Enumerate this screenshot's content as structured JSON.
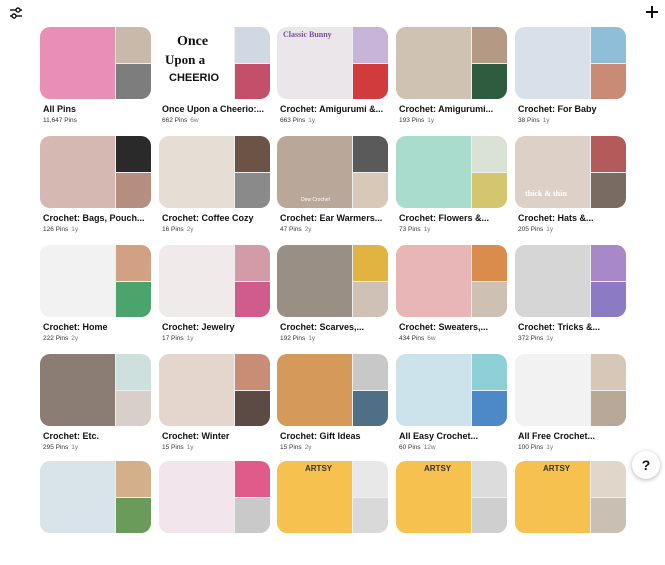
{
  "toolbar": {
    "filter_icon": "filter-sliders-icon",
    "add_icon": "plus-icon"
  },
  "help": {
    "label": "?"
  },
  "boards": [
    {
      "title": "All Pins",
      "count": "11,647 Pins",
      "age": "",
      "colors": [
        "#e98fb5",
        "#c9b9a8",
        "#7d7d7d"
      ]
    },
    {
      "title": "Once Upon a Cheerio:...",
      "count": "662 Pins",
      "age": "6w",
      "colors": [
        "#ffffff",
        "#d0d9e3",
        "#c34f6b"
      ]
    },
    {
      "title": "Crochet: Amigurumi &...",
      "count": "663 Pins",
      "age": "1y",
      "colors": [
        "#eae6ea",
        "#c8b3d9",
        "#d23b3b"
      ]
    },
    {
      "title": "Crochet: Amigurumi...",
      "count": "193 Pins",
      "age": "1y",
      "colors": [
        "#cfc2b3",
        "#b49a85",
        "#2f5c3f"
      ]
    },
    {
      "title": "Crochet: For Baby",
      "count": "38 Pins",
      "age": "1y",
      "colors": [
        "#d8e1e9",
        "#8fbfd8",
        "#c98b73"
      ]
    },
    {
      "title": "Crochet: Bags, Pouch...",
      "count": "126 Pins",
      "age": "1y",
      "colors": [
        "#d5b8b2",
        "#2a2a2a",
        "#b58e7f"
      ]
    },
    {
      "title": "Crochet: Coffee Cozy",
      "count": "16 Pins",
      "age": "2y",
      "colors": [
        "#e6ddd4",
        "#6b5445",
        "#8a8a8a"
      ]
    },
    {
      "title": "Crochet: Ear Warmers...",
      "count": "47 Pins",
      "age": "2y",
      "colors": [
        "#b9a89a",
        "#5a5a5a",
        "#d8c8b8"
      ]
    },
    {
      "title": "Crochet: Flowers &...",
      "count": "73 Pins",
      "age": "1y",
      "colors": [
        "#a9dccd",
        "#d9e2d5",
        "#d4c66e"
      ]
    },
    {
      "title": "Crochet: Hats &...",
      "count": "205 Pins",
      "age": "1y",
      "colors": [
        "#ddd0c6",
        "#b55a5a",
        "#7a6b62"
      ]
    },
    {
      "title": "Crochet: Home",
      "count": "222 Pins",
      "age": "2y",
      "colors": [
        "#f2f2f2",
        "#d2a184",
        "#4aa46b"
      ]
    },
    {
      "title": "Crochet: Jewelry",
      "count": "17 Pins",
      "age": "1y",
      "colors": [
        "#f0eaea",
        "#d39aa8",
        "#cf5c8a"
      ]
    },
    {
      "title": "Crochet: Scarves,...",
      "count": "192 Pins",
      "age": "1y",
      "colors": [
        "#9a8f85",
        "#e2b340",
        "#cfc1b6"
      ]
    },
    {
      "title": "Crochet: Sweaters,...",
      "count": "434 Pins",
      "age": "6w",
      "colors": [
        "#e9b6b8",
        "#d98c4b",
        "#cfc0b4"
      ]
    },
    {
      "title": "Crochet: Tricks &...",
      "count": "372 Pins",
      "age": "1y",
      "colors": [
        "#d6d6d6",
        "#a888c8",
        "#8d7ac4"
      ]
    },
    {
      "title": "Crochet: Etc.",
      "count": "295 Pins",
      "age": "1y",
      "colors": [
        "#8c7d74",
        "#cde0de",
        "#d8cfc8"
      ]
    },
    {
      "title": "Crochet: Winter",
      "count": "15 Pins",
      "age": "1y",
      "colors": [
        "#e4d6cc",
        "#c98d75",
        "#5c4a44"
      ]
    },
    {
      "title": "Crochet: Gift Ideas",
      "count": "15 Pins",
      "age": "2y",
      "colors": [
        "#d59a5a",
        "#c8c8c8",
        "#4f6f86"
      ]
    },
    {
      "title": "All Easy Crochet...",
      "count": "60 Pins",
      "age": "12w",
      "colors": [
        "#cde3ec",
        "#8fd0d6",
        "#4d89c7"
      ]
    },
    {
      "title": "All Free Crochet...",
      "count": "100 Pins",
      "age": "1y",
      "colors": [
        "#f2f2f2",
        "#d7c7b6",
        "#b8a897"
      ]
    },
    {
      "title": "",
      "count": "",
      "age": "",
      "colors": [
        "#d9e4ea",
        "#d3b08a",
        "#6a9b5b"
      ]
    },
    {
      "title": "",
      "count": "",
      "age": "",
      "colors": [
        "#f2e6ec",
        "#e05a8a",
        "#c9c9c9"
      ]
    },
    {
      "title": "",
      "count": "",
      "age": "",
      "colors": [
        "#f6c14e",
        "#e8e8e8",
        "#d9d9d9"
      ]
    },
    {
      "title": "",
      "count": "",
      "age": "",
      "colors": [
        "#f6c14e",
        "#dcdcdc",
        "#cfcfcf"
      ]
    },
    {
      "title": "",
      "count": "",
      "age": "",
      "colors": [
        "#f6c14e",
        "#e0d6ca",
        "#c9bfb3"
      ]
    }
  ],
  "cover_text": {
    "once_upon": [
      "Once",
      "Upon a",
      "CHEERIO"
    ],
    "classic_bunny": "Classic Bunny",
    "thick_thin": "thick & thin",
    "artsy": "ARTSY",
    "dew": "Dew Crochet"
  }
}
